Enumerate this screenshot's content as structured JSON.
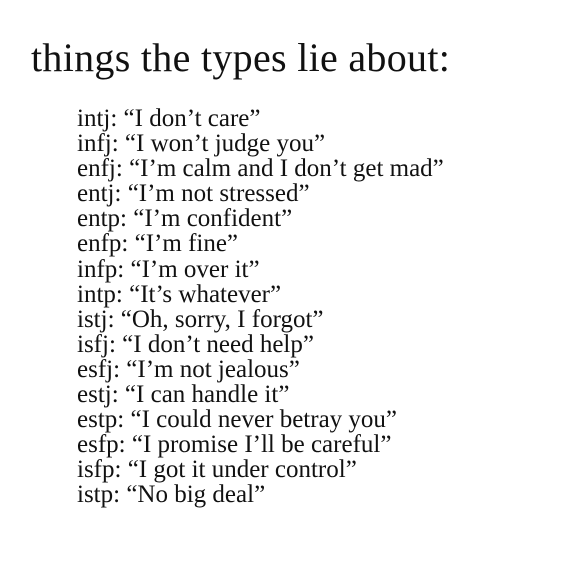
{
  "title": "things the types lie about:",
  "items": [
    {
      "type": "intj:",
      "quote": "“I don’t care”"
    },
    {
      "type": "infj:",
      "quote": "“I won’t judge you”"
    },
    {
      "type": "enfj:",
      "quote": "“I’m calm and I don’t get mad”"
    },
    {
      "type": "entj:",
      "quote": "“I’m not stressed”"
    },
    {
      "type": "entp:",
      "quote": "“I’m confident”"
    },
    {
      "type": "enfp:",
      "quote": "“I’m fine”"
    },
    {
      "type": "infp:",
      "quote": "“I’m over it”"
    },
    {
      "type": "intp:",
      "quote": "“It’s whatever”"
    },
    {
      "type": "istj:",
      "quote": "“Oh, sorry, I forgot”"
    },
    {
      "type": "isfj:",
      "quote": "“I don’t need help”"
    },
    {
      "type": "esfj:",
      "quote": "“I’m not jealous”"
    },
    {
      "type": "estj:",
      "quote": "“I can handle it”"
    },
    {
      "type": "estp:",
      "quote": "“I could never betray you”"
    },
    {
      "type": "esfp:",
      "quote": "“I promise I’ll be careful”"
    },
    {
      "type": "isfp:",
      "quote": "“I got it under control”"
    },
    {
      "type": "istp:",
      "quote": "“No big deal”"
    }
  ]
}
